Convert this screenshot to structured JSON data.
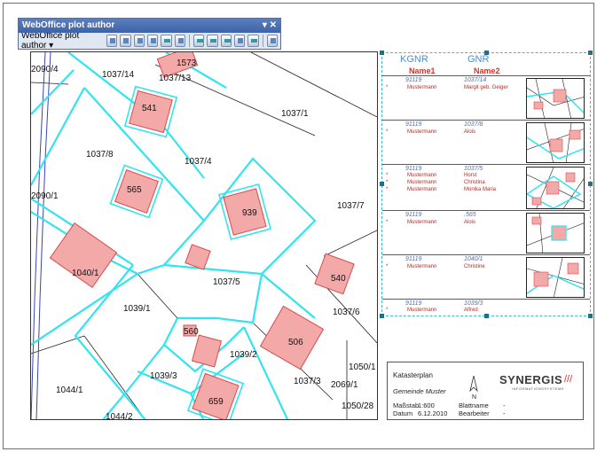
{
  "toolbar": {
    "title": "WebOffice plot author",
    "controls": "▾ ✕",
    "menu_label": "WebOffice plot author ▾",
    "buttons": [
      "new-plot-icon",
      "open-plot-icon",
      "save-plot-icon",
      "add-element-icon",
      "properties-icon",
      "layout-icon",
      "text-icon",
      "table-icon",
      "table-add-icon",
      "frame-icon",
      "cut-icon",
      "refresh-icon"
    ]
  },
  "map": {
    "parcel_labels": [
      "2090/4",
      "1037/14",
      "1573",
      "1037/13",
      "541",
      "1037/1",
      "1037/8",
      "1037/4",
      "565",
      "2090/1",
      "939",
      "1037/7",
      "1040/1",
      "1037/5",
      "540",
      "1039/1",
      "1037/6",
      "560",
      "506",
      "1039/2",
      "1050/1",
      "1039/3",
      "1037/3",
      "2069/1",
      "1044/1",
      "659",
      "1050/28",
      "1044/2"
    ]
  },
  "panel": {
    "header": {
      "kgnr": "KGNR",
      "gnr": "GNR",
      "name1": "Name1",
      "name2": "Name2"
    },
    "rows": [
      {
        "kgnr": "91119",
        "gnr": "1037/14",
        "owners": [
          {
            "marker": "*",
            "name1": "Mustermann",
            "name2": "Margit geb. Geiger"
          }
        ]
      },
      {
        "kgnr": "91119",
        "gnr": "1037/8",
        "owners": [
          {
            "marker": "*",
            "name1": "Mustermann",
            "name2": "Alois"
          }
        ]
      },
      {
        "kgnr": "91119",
        "gnr": "1037/5",
        "owners": [
          {
            "marker": "*",
            "name1": "Mustermann",
            "name2": "Horst"
          },
          {
            "marker": "*",
            "name1": "Mustermann",
            "name2": "Christina"
          },
          {
            "marker": "*",
            "name1": "Mustermann",
            "name2": "Monika Maria"
          }
        ]
      },
      {
        "kgnr": "91119",
        "gnr": ".565",
        "owners": [
          {
            "marker": "*",
            "name1": "Mustermann",
            "name2": "Alois"
          }
        ]
      },
      {
        "kgnr": "91119",
        "gnr": "1040/1",
        "owners": [
          {
            "marker": "*",
            "name1": "Mustermann",
            "name2": "Christine"
          }
        ]
      },
      {
        "kgnr": "91119",
        "gnr": "1039/3",
        "owners": [
          {
            "marker": "*",
            "name1": "Mustermann",
            "name2": "Alfred"
          }
        ]
      }
    ]
  },
  "legend": {
    "title": "Katasterplan",
    "municipality": "Gemeinde Muster",
    "scale_label": "Maßstab",
    "scale_value": "1:600",
    "date_label": "Datum",
    "date_value": "6.12.2010",
    "sheet_label": "Blattname",
    "sheet_value": "-",
    "editor_label": "Bearbeiter",
    "editor_value": "-",
    "north": "N",
    "logo": "SYNERGIS",
    "logo_sub": "INFORMATIONSSYSTEME"
  },
  "colors": {
    "parcel_line": "#33e3ef",
    "building_fill": "#f4a9a9",
    "building_stroke": "#d84a4a",
    "header_blue": "#4a8fd8",
    "header_red": "#d2342c"
  }
}
